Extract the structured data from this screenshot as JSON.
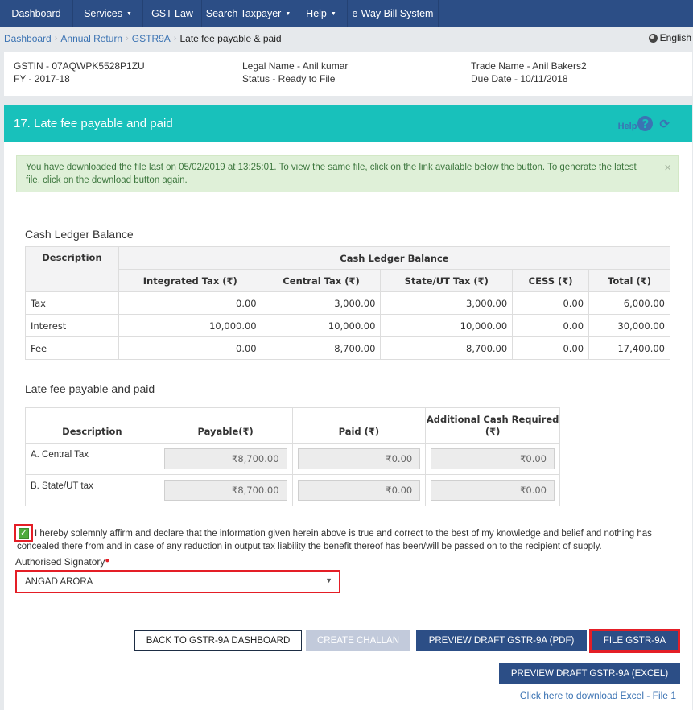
{
  "nav": {
    "items": [
      {
        "label": "Dashboard",
        "dropdown": false
      },
      {
        "label": "Services",
        "dropdown": true
      },
      {
        "label": "GST Law",
        "dropdown": false
      },
      {
        "label": "Search Taxpayer",
        "dropdown": true
      },
      {
        "label": "Help",
        "dropdown": true
      },
      {
        "label": "e-Way Bill System",
        "dropdown": false
      }
    ],
    "caret": "▼"
  },
  "breadcrumb": {
    "items": [
      "Dashboard",
      "Annual Return",
      "GSTR9A"
    ],
    "current": "Late fee payable & paid",
    "separator": "›"
  },
  "language": {
    "label": "English",
    "icon": "globe-icon"
  },
  "taxpayer": {
    "gstin": "GSTIN - 07AQWPK5528P1ZU",
    "fy": "FY - 2017-18",
    "legal_name": "Legal Name - Anil kumar",
    "status": "Status - Ready to File",
    "trade_name": "Trade Name - Anil Bakers2",
    "due_date": "Due Date - 10/11/2018"
  },
  "panel": {
    "title": "17. Late fee payable and paid",
    "help_label": "Help",
    "help_icon": "?",
    "refresh_icon": "⟳"
  },
  "alert": {
    "message": "You have downloaded the file last on 05/02/2019 at 13:25:01. To view the same file, click on the link available below the button. To generate the latest file, click on the download button again.",
    "close": "×"
  },
  "cash_ledger": {
    "title": "Cash Ledger Balance",
    "header_desc": "Description",
    "header_group": "Cash Ledger Balance",
    "columns": [
      "Integrated Tax (₹)",
      "Central Tax (₹)",
      "State/UT Tax (₹)",
      "CESS (₹)",
      "Total (₹)"
    ],
    "rows": [
      {
        "desc": "Tax",
        "values": [
          "0.00",
          "3,000.00",
          "3,000.00",
          "0.00",
          "6,000.00"
        ]
      },
      {
        "desc": "Interest",
        "values": [
          "10,000.00",
          "10,000.00",
          "10,000.00",
          "0.00",
          "30,000.00"
        ]
      },
      {
        "desc": "Fee",
        "values": [
          "0.00",
          "8,700.00",
          "8,700.00",
          "0.00",
          "17,400.00"
        ]
      }
    ]
  },
  "late_fee": {
    "title": "Late fee payable and paid",
    "columns": [
      "Description",
      "Payable(₹)",
      "Paid (₹)",
      "Additional Cash Required (₹)"
    ],
    "rows": [
      {
        "desc": "A. Central Tax",
        "payable": "₹8,700.00",
        "paid": "₹0.00",
        "additional": "₹0.00"
      },
      {
        "desc": "B. State/UT tax",
        "payable": "₹8,700.00",
        "paid": "₹0.00",
        "additional": "₹0.00"
      }
    ]
  },
  "declaration": {
    "checked": true,
    "check_glyph": "✓",
    "text": "I hereby solemnly affirm and declare that the information given herein above is true and correct to the best of my knowledge and belief and nothing has concealed there from and in case of any reduction in output tax liability the benefit thereof has been/will be passed on to the recipient of supply."
  },
  "signatory": {
    "label": "Authorised Signatory",
    "required_mark": "●",
    "selected": "ANGAD ARORA",
    "arrow": "▼"
  },
  "buttons": {
    "back": "BACK TO GSTR-9A DASHBOARD",
    "create_challan": "CREATE CHALLAN",
    "preview_pdf": "PREVIEW DRAFT GSTR-9A (PDF)",
    "file": "FILE GSTR-9A",
    "preview_excel": "PREVIEW DRAFT GSTR-9A (EXCEL)"
  },
  "excel_link": "Click here to download Excel - File 1",
  "colors": {
    "nav_bg": "#2c4e86",
    "panel_header": "#18c1bb",
    "alert_bg": "#dff0d8",
    "highlight_red": "#e41e26",
    "link": "#3b73b3",
    "disabled_btn": "#c2cadb"
  }
}
